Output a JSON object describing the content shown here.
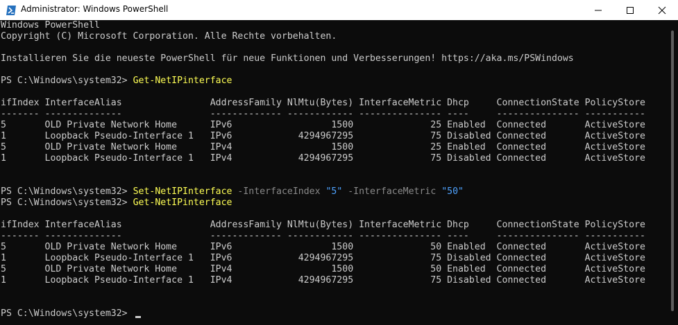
{
  "window": {
    "title": "Administrator: Windows PowerShell"
  },
  "console": {
    "lines": [
      "Windows PowerShell",
      "Copyright (C) Microsoft Corporation. Alle Rechte vorbehalten.",
      "",
      "Installieren Sie die neueste PowerShell für neue Funktionen und Verbesserungen! https://aka.ms/PSWindows",
      "",
      "PS C:\\Windows\\system32> ",
      "",
      "ifIndex InterfaceAlias                AddressFamily NlMtu(Bytes) InterfaceMetric Dhcp     ConnectionState PolicyStore",
      "------- --------------                ------------- ------------ --------------- ----     --------------- -----------",
      "5       OLD Private Network Home      IPv6                  1500              25 Enabled  Connected       ActiveStore",
      "1       Loopback Pseudo-Interface 1   IPv6            4294967295              75 Disabled Connected       ActiveStore",
      "5       OLD Private Network Home      IPv4                  1500              25 Enabled  Connected       ActiveStore",
      "1       Loopback Pseudo-Interface 1   IPv4            4294967295              75 Disabled Connected       ActiveStore",
      "",
      "",
      "PS C:\\Windows\\system32> ",
      "PS C:\\Windows\\system32> ",
      "",
      "ifIndex InterfaceAlias                AddressFamily NlMtu(Bytes) InterfaceMetric Dhcp     ConnectionState PolicyStore",
      "------- --------------                ------------- ------------ --------------- ----     --------------- -----------",
      "5       OLD Private Network Home      IPv6                  1500              50 Enabled  Connected       ActiveStore",
      "1       Loopback Pseudo-Interface 1   IPv6            4294967295              75 Disabled Connected       ActiveStore",
      "5       OLD Private Network Home      IPv4                  1500              50 Enabled  Connected       ActiveStore",
      "1       Loopback Pseudo-Interface 1   IPv4            4294967295              75 Disabled Connected       ActiveStore",
      "",
      "",
      "PS C:\\Windows\\system32> "
    ],
    "commands": {
      "get_1": "Get-NetIPinterface",
      "set_cmd": "Set-NetIPInterface",
      "set_p1": " -InterfaceIndex ",
      "set_v1": "\"5\"",
      "set_p2": " -InterfaceMetric ",
      "set_v2": "\"50\"",
      "get_2": "Get-NetIPinterface"
    }
  },
  "colors": {
    "background": "#0c0c0c",
    "text": "#cccccc",
    "command": "#ffff55",
    "parameter": "#8a8a8a",
    "string": "#4fa3ff"
  },
  "icons": {
    "app": "powershell-icon",
    "minimize": "minimize-icon",
    "maximize": "maximize-icon",
    "close": "close-icon"
  }
}
